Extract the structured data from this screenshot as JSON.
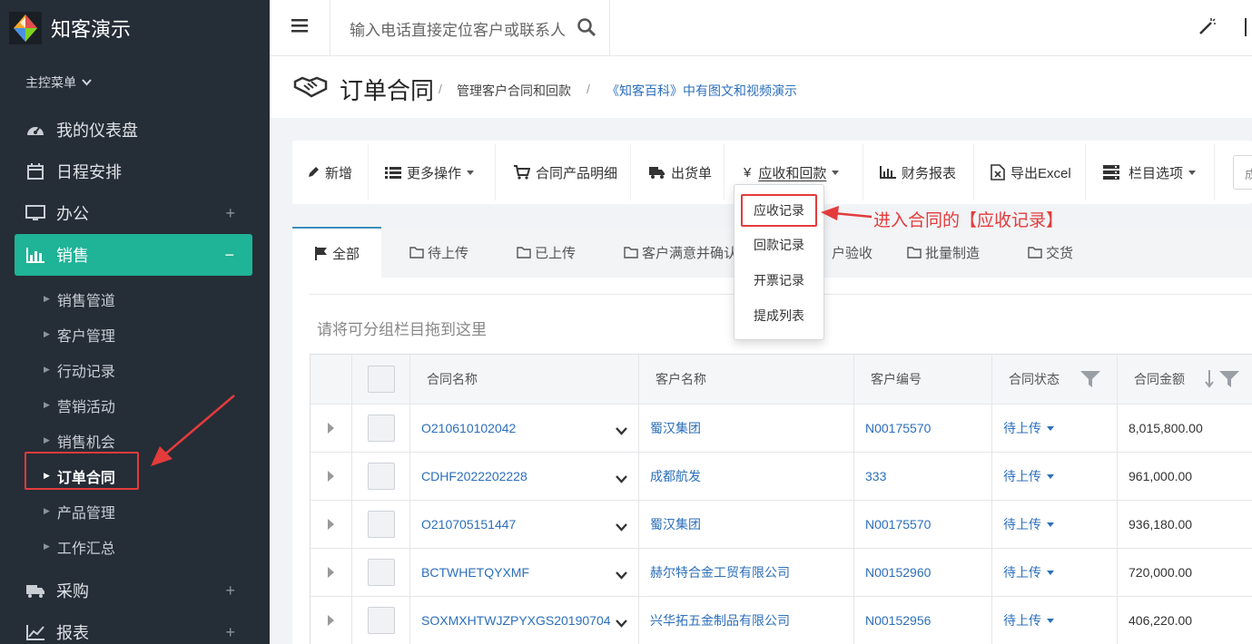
{
  "sidebar": {
    "brand": "知客演示",
    "menu_head": "主控菜单",
    "items": [
      {
        "label": "我的仪表盘",
        "icon": "dashboard-icon"
      },
      {
        "label": "日程安排",
        "icon": "calendar-icon"
      },
      {
        "label": "办公",
        "icon": "monitor-icon",
        "expand": "+"
      },
      {
        "label": "销售",
        "icon": "bar-chart-icon",
        "expand": "−"
      }
    ],
    "sales_sub": [
      "销售管道",
      "客户管理",
      "行动记录",
      "营销活动",
      "销售机会",
      "订单合同",
      "产品管理",
      "工作汇总"
    ],
    "bottom_items": [
      {
        "label": "采购",
        "icon": "truck-icon",
        "expand": "+"
      },
      {
        "label": "报表",
        "icon": "line-chart-icon",
        "expand": "+"
      }
    ]
  },
  "topbar": {
    "search_placeholder": "输入电话直接定位客户或联系人"
  },
  "page": {
    "title": "订单合同",
    "desc": "管理客户合同和回款",
    "link": "《知客百科》中有图文和视频演示"
  },
  "toolbar": {
    "new": "新增",
    "more": "更多操作",
    "product_detail": "合同产品明细",
    "shipment": "出货单",
    "receivable_symbol": "¥",
    "receivable": "应收和回款",
    "finance_report": "财务报表",
    "export": "导出Excel",
    "columns": "栏目选项",
    "input_stub": "成"
  },
  "dropdown": [
    "应收记录",
    "回款记录",
    "开票记录",
    "提成列表"
  ],
  "annotation": "进入合同的【应收记录】",
  "tabs": [
    "全部",
    "待上传",
    "已上传",
    "客户满意并确认",
    "户验收",
    "批量制造",
    "交货"
  ],
  "group_hint": "请将可分组栏目拖到这里",
  "table": {
    "headers": {
      "name": "合同名称",
      "customer": "客户名称",
      "code": "客户编号",
      "status": "合同状态",
      "amount": "合同金额"
    },
    "rows": [
      {
        "name": "O210610102042",
        "customer": "蜀汉集团",
        "code": "N00175570",
        "status": "待上传",
        "amount": "8,015,800.00"
      },
      {
        "name": "CDHF2022202228",
        "customer": "成都航发",
        "code": "333",
        "status": "待上传",
        "amount": "961,000.00"
      },
      {
        "name": "O210705151447",
        "customer": "蜀汉集团",
        "code": "N00175570",
        "status": "待上传",
        "amount": "936,180.00"
      },
      {
        "name": "BCTWHETQYXMF",
        "customer": "赫尔特合金工贸有限公司",
        "code": "N00152960",
        "status": "待上传",
        "amount": "720,000.00"
      },
      {
        "name": "SOXMXHTWJZPYXGS20190704",
        "customer": "兴华拓五金制品有限公司",
        "code": "N00152956",
        "status": "待上传",
        "amount": "406,220.00"
      }
    ]
  },
  "colors": {
    "sidebar_bg": "#252d37",
    "active_green": "#1fb397",
    "link_blue": "#2c6fbb",
    "annotation_red": "#e43b3b"
  }
}
